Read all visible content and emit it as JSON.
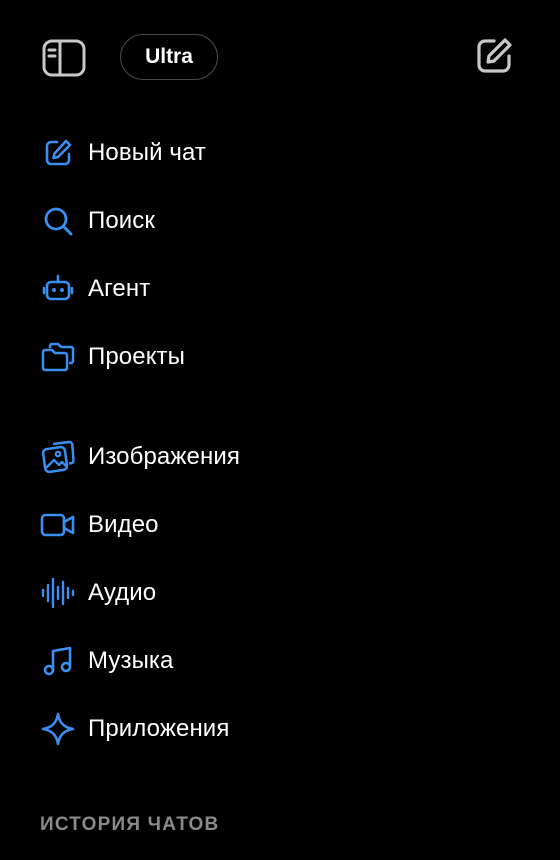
{
  "header": {
    "plan_badge": "Ultra"
  },
  "nav": {
    "primary": [
      {
        "label": "Новый чат",
        "icon": "edit-icon"
      },
      {
        "label": "Поиск",
        "icon": "search-icon"
      },
      {
        "label": "Агент",
        "icon": "robot-icon"
      },
      {
        "label": "Проекты",
        "icon": "folders-icon"
      }
    ],
    "media": [
      {
        "label": "Изображения",
        "icon": "images-icon"
      },
      {
        "label": "Видео",
        "icon": "video-icon"
      },
      {
        "label": "Аудио",
        "icon": "audio-waveform-icon"
      },
      {
        "label": "Музыка",
        "icon": "music-note-icon"
      },
      {
        "label": "Приложения",
        "icon": "sparkle-icon"
      }
    ]
  },
  "history": {
    "header": "ИСТОРИЯ ЧАТОВ"
  },
  "colors": {
    "background": "#000000",
    "accent": "#3B8FF3",
    "text": "#FFFFFF",
    "muted_text": "#8A8A8A",
    "header_icon": "#C8C8C8",
    "badge_border": "#4A4A4A"
  }
}
